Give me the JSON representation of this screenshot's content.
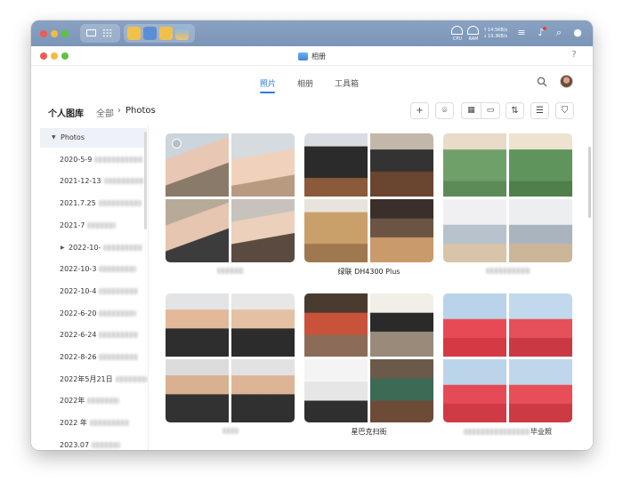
{
  "nas_bar": {
    "cpu_label": "CPU",
    "ram_label": "RAM",
    "upload": "14.5KB/s",
    "download": "19.3KB/s"
  },
  "app": {
    "title": "相册",
    "help": "?"
  },
  "tabs": [
    {
      "label": "照片",
      "active": true
    },
    {
      "label": "相册",
      "active": false
    },
    {
      "label": "工具箱",
      "active": false
    }
  ],
  "toolbar": {
    "library": "个人图库",
    "all": "全部",
    "separator": "›",
    "current_folder": "Photos",
    "add_icon": "plus-icon",
    "face_icon": "face-scan-icon",
    "grid_icon": "grid-icon",
    "folder_icon": "folder-icon",
    "sort_icon": "sort-icon",
    "list_icon": "list-icon",
    "filter_icon": "filter-icon"
  },
  "sidebar": {
    "items": [
      {
        "label": "Photos",
        "expanded": true,
        "selected": true
      },
      {
        "label": "2020-5-9",
        "blurred": true
      },
      {
        "label": "2021-12-13",
        "blurred": true
      },
      {
        "label": "2021.7.25",
        "blurred": true
      },
      {
        "label": "2021-7",
        "blurred": true
      },
      {
        "label": "2022-10-",
        "blurred": true,
        "collapsed": true
      },
      {
        "label": "2022-10-3",
        "blurred": true
      },
      {
        "label": "2022-10-4",
        "blurred": true
      },
      {
        "label": "2022-6-20",
        "blurred": true
      },
      {
        "label": "2022-6-24",
        "blurred": true
      },
      {
        "label": "2022-8-26",
        "blurred": true
      },
      {
        "label": "2022年5月21日",
        "blurred": true
      },
      {
        "label": "2022年",
        "blurred": true
      },
      {
        "label": "2022 年",
        "blurred": true
      },
      {
        "label": "2023.07",
        "blurred": true
      }
    ]
  },
  "albums": [
    {
      "label": "",
      "theme": "baby"
    },
    {
      "label": "绿联 DH4300 Plus",
      "theme": "nas"
    },
    {
      "label": "",
      "theme": "coffee"
    },
    {
      "label": "",
      "theme": "family"
    },
    {
      "label": "星巴克扫街",
      "theme": "starbucks"
    },
    {
      "label": "毕业照",
      "theme": "graduation"
    }
  ],
  "colors": {
    "accent": "#2a7ae2",
    "nas_bar": "#7b95b8"
  }
}
